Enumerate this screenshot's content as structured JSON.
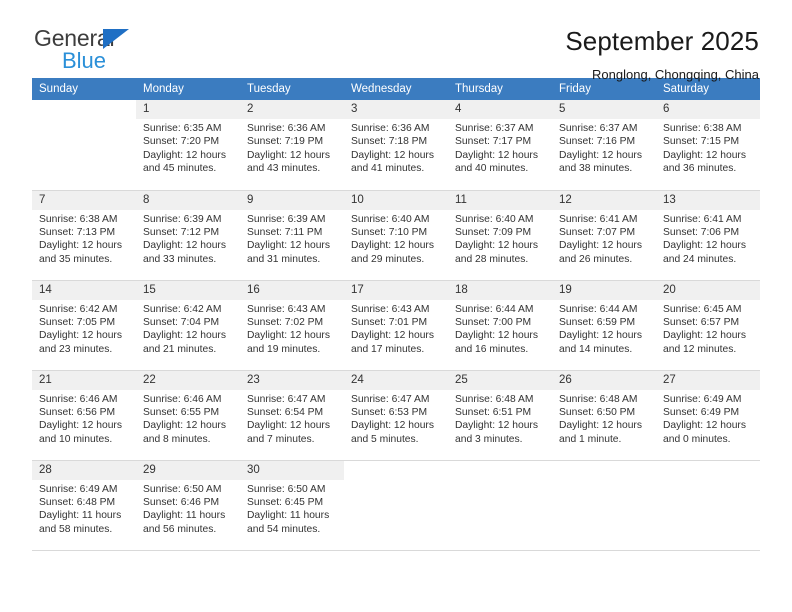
{
  "brand": {
    "name_part1": "General",
    "name_part2": "Blue",
    "logo_icon": "blue-triangle-icon"
  },
  "header": {
    "title": "September 2025",
    "location": "Ronglong, Chongqing, China"
  },
  "colors": {
    "header_blue": "#3b7cc0",
    "brand_blue": "#2a8fd8",
    "daynum_bg": "#f0f0f0",
    "text": "#333333"
  },
  "weekday_headers": [
    "Sunday",
    "Monday",
    "Tuesday",
    "Wednesday",
    "Thursday",
    "Friday",
    "Saturday"
  ],
  "labels": {
    "sunrise_prefix": "Sunrise:",
    "sunset_prefix": "Sunset:",
    "daylight_prefix": "Daylight:"
  },
  "weeks": [
    [
      {
        "day": "",
        "empty": true
      },
      {
        "day": "1",
        "sunrise": "Sunrise: 6:35 AM",
        "sunset": "Sunset: 7:20 PM",
        "daylight1": "Daylight: 12 hours",
        "daylight2": "and 45 minutes."
      },
      {
        "day": "2",
        "sunrise": "Sunrise: 6:36 AM",
        "sunset": "Sunset: 7:19 PM",
        "daylight1": "Daylight: 12 hours",
        "daylight2": "and 43 minutes."
      },
      {
        "day": "3",
        "sunrise": "Sunrise: 6:36 AM",
        "sunset": "Sunset: 7:18 PM",
        "daylight1": "Daylight: 12 hours",
        "daylight2": "and 41 minutes."
      },
      {
        "day": "4",
        "sunrise": "Sunrise: 6:37 AM",
        "sunset": "Sunset: 7:17 PM",
        "daylight1": "Daylight: 12 hours",
        "daylight2": "and 40 minutes."
      },
      {
        "day": "5",
        "sunrise": "Sunrise: 6:37 AM",
        "sunset": "Sunset: 7:16 PM",
        "daylight1": "Daylight: 12 hours",
        "daylight2": "and 38 minutes."
      },
      {
        "day": "6",
        "sunrise": "Sunrise: 6:38 AM",
        "sunset": "Sunset: 7:15 PM",
        "daylight1": "Daylight: 12 hours",
        "daylight2": "and 36 minutes."
      }
    ],
    [
      {
        "day": "7",
        "sunrise": "Sunrise: 6:38 AM",
        "sunset": "Sunset: 7:13 PM",
        "daylight1": "Daylight: 12 hours",
        "daylight2": "and 35 minutes."
      },
      {
        "day": "8",
        "sunrise": "Sunrise: 6:39 AM",
        "sunset": "Sunset: 7:12 PM",
        "daylight1": "Daylight: 12 hours",
        "daylight2": "and 33 minutes."
      },
      {
        "day": "9",
        "sunrise": "Sunrise: 6:39 AM",
        "sunset": "Sunset: 7:11 PM",
        "daylight1": "Daylight: 12 hours",
        "daylight2": "and 31 minutes."
      },
      {
        "day": "10",
        "sunrise": "Sunrise: 6:40 AM",
        "sunset": "Sunset: 7:10 PM",
        "daylight1": "Daylight: 12 hours",
        "daylight2": "and 29 minutes."
      },
      {
        "day": "11",
        "sunrise": "Sunrise: 6:40 AM",
        "sunset": "Sunset: 7:09 PM",
        "daylight1": "Daylight: 12 hours",
        "daylight2": "and 28 minutes."
      },
      {
        "day": "12",
        "sunrise": "Sunrise: 6:41 AM",
        "sunset": "Sunset: 7:07 PM",
        "daylight1": "Daylight: 12 hours",
        "daylight2": "and 26 minutes."
      },
      {
        "day": "13",
        "sunrise": "Sunrise: 6:41 AM",
        "sunset": "Sunset: 7:06 PM",
        "daylight1": "Daylight: 12 hours",
        "daylight2": "and 24 minutes."
      }
    ],
    [
      {
        "day": "14",
        "sunrise": "Sunrise: 6:42 AM",
        "sunset": "Sunset: 7:05 PM",
        "daylight1": "Daylight: 12 hours",
        "daylight2": "and 23 minutes."
      },
      {
        "day": "15",
        "sunrise": "Sunrise: 6:42 AM",
        "sunset": "Sunset: 7:04 PM",
        "daylight1": "Daylight: 12 hours",
        "daylight2": "and 21 minutes."
      },
      {
        "day": "16",
        "sunrise": "Sunrise: 6:43 AM",
        "sunset": "Sunset: 7:02 PM",
        "daylight1": "Daylight: 12 hours",
        "daylight2": "and 19 minutes."
      },
      {
        "day": "17",
        "sunrise": "Sunrise: 6:43 AM",
        "sunset": "Sunset: 7:01 PM",
        "daylight1": "Daylight: 12 hours",
        "daylight2": "and 17 minutes."
      },
      {
        "day": "18",
        "sunrise": "Sunrise: 6:44 AM",
        "sunset": "Sunset: 7:00 PM",
        "daylight1": "Daylight: 12 hours",
        "daylight2": "and 16 minutes."
      },
      {
        "day": "19",
        "sunrise": "Sunrise: 6:44 AM",
        "sunset": "Sunset: 6:59 PM",
        "daylight1": "Daylight: 12 hours",
        "daylight2": "and 14 minutes."
      },
      {
        "day": "20",
        "sunrise": "Sunrise: 6:45 AM",
        "sunset": "Sunset: 6:57 PM",
        "daylight1": "Daylight: 12 hours",
        "daylight2": "and 12 minutes."
      }
    ],
    [
      {
        "day": "21",
        "sunrise": "Sunrise: 6:46 AM",
        "sunset": "Sunset: 6:56 PM",
        "daylight1": "Daylight: 12 hours",
        "daylight2": "and 10 minutes."
      },
      {
        "day": "22",
        "sunrise": "Sunrise: 6:46 AM",
        "sunset": "Sunset: 6:55 PM",
        "daylight1": "Daylight: 12 hours",
        "daylight2": "and 8 minutes."
      },
      {
        "day": "23",
        "sunrise": "Sunrise: 6:47 AM",
        "sunset": "Sunset: 6:54 PM",
        "daylight1": "Daylight: 12 hours",
        "daylight2": "and 7 minutes."
      },
      {
        "day": "24",
        "sunrise": "Sunrise: 6:47 AM",
        "sunset": "Sunset: 6:53 PM",
        "daylight1": "Daylight: 12 hours",
        "daylight2": "and 5 minutes."
      },
      {
        "day": "25",
        "sunrise": "Sunrise: 6:48 AM",
        "sunset": "Sunset: 6:51 PM",
        "daylight1": "Daylight: 12 hours",
        "daylight2": "and 3 minutes."
      },
      {
        "day": "26",
        "sunrise": "Sunrise: 6:48 AM",
        "sunset": "Sunset: 6:50 PM",
        "daylight1": "Daylight: 12 hours",
        "daylight2": "and 1 minute."
      },
      {
        "day": "27",
        "sunrise": "Sunrise: 6:49 AM",
        "sunset": "Sunset: 6:49 PM",
        "daylight1": "Daylight: 12 hours",
        "daylight2": "and 0 minutes."
      }
    ],
    [
      {
        "day": "28",
        "sunrise": "Sunrise: 6:49 AM",
        "sunset": "Sunset: 6:48 PM",
        "daylight1": "Daylight: 11 hours",
        "daylight2": "and 58 minutes."
      },
      {
        "day": "29",
        "sunrise": "Sunrise: 6:50 AM",
        "sunset": "Sunset: 6:46 PM",
        "daylight1": "Daylight: 11 hours",
        "daylight2": "and 56 minutes."
      },
      {
        "day": "30",
        "sunrise": "Sunrise: 6:50 AM",
        "sunset": "Sunset: 6:45 PM",
        "daylight1": "Daylight: 11 hours",
        "daylight2": "and 54 minutes."
      },
      {
        "day": "",
        "empty": true
      },
      {
        "day": "",
        "empty": true
      },
      {
        "day": "",
        "empty": true
      },
      {
        "day": "",
        "empty": true
      }
    ]
  ]
}
